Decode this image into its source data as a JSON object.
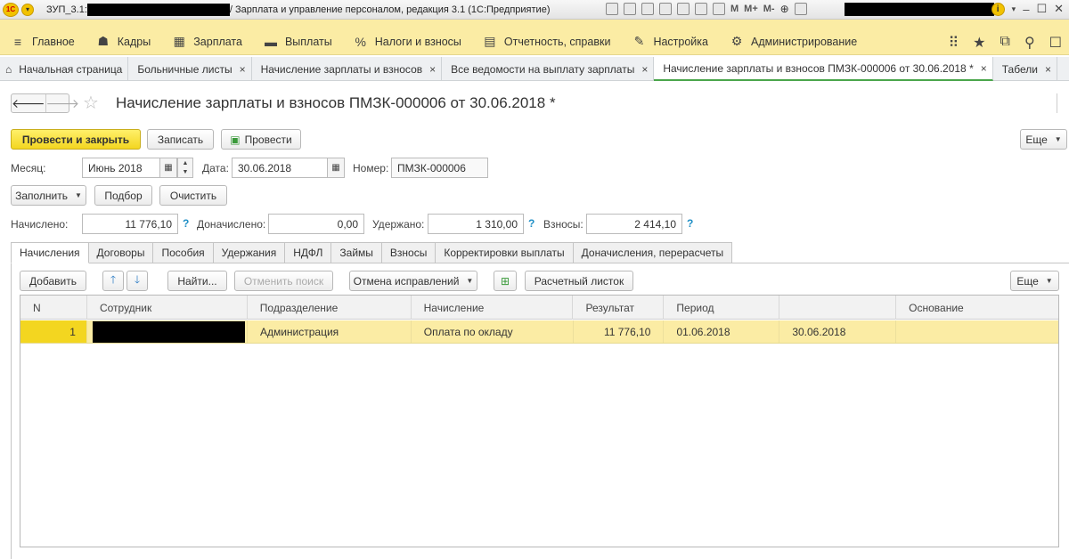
{
  "titlebar": {
    "logo": "1С",
    "app_prefix": "ЗУП_3.1:",
    "title": "/ Зарплата и управление персоналом, редакция 3.1  (1С:Предприятие)",
    "m_buttons": [
      "M",
      "M+",
      "M-"
    ]
  },
  "main_menu": [
    {
      "icon": "≡",
      "label": "Главное"
    },
    {
      "icon": "👥",
      "label": "Кадры"
    },
    {
      "icon": "▦",
      "label": "Зарплата"
    },
    {
      "icon": "▬",
      "label": "Выплаты"
    },
    {
      "icon": "%",
      "label": "Налоги и взносы"
    },
    {
      "icon": "▤",
      "label": "Отчетность, справки"
    },
    {
      "icon": "🔧",
      "label": "Настройка"
    },
    {
      "icon": "⚙",
      "label": "Администрирование"
    }
  ],
  "open_tabs": {
    "home": "Начальная страница",
    "tabs": [
      "Больничные листы",
      "Начисление зарплаты и взносов",
      "Все ведомости на выплату зарплаты",
      "Начисление зарплаты и взносов ПМЗК-000006 от 30.06.2018 *",
      "Табели"
    ],
    "close_symbol": "×"
  },
  "form": {
    "title": "Начисление зарплаты и взносов ПМЗК-000006 от 30.06.2018 *",
    "toolbar": {
      "post_and_close": "Провести и закрыть",
      "save": "Записать",
      "post": "Провести",
      "more": "Еще"
    },
    "month_label": "Месяц:",
    "month_value": "Июнь 2018",
    "date_label": "Дата:",
    "date_value": "30.06.2018",
    "number_label": "Номер:",
    "number_value": "ПМЗК-000006",
    "fill_button": "Заполнить",
    "select_button": "Подбор",
    "clear_button": "Очистить",
    "accrued_label": "Начислено:",
    "accrued_value": "11 776,10",
    "additional_label": "Доначислено:",
    "additional_value": "0,00",
    "withheld_label": "Удержано:",
    "withheld_value": "1 310,00",
    "contributions_label": "Взносы:",
    "contributions_value": "2 414,10",
    "help_symbol": "?"
  },
  "page_tabs": [
    "Начисления",
    "Договоры",
    "Пособия",
    "Удержания",
    "НДФЛ",
    "Займы",
    "Взносы",
    "Корректировки выплаты",
    "Доначисления, перерасчеты"
  ],
  "table_toolbar": {
    "add": "Добавить",
    "find": "Найти...",
    "cancel_search": "Отменить поиск",
    "cancel_corrections": "Отмена исправлений",
    "payslip": "Расчетный листок",
    "more": "Еще"
  },
  "table": {
    "columns": [
      "N",
      "Сотрудник",
      "Подразделение",
      "Начисление",
      "Результат",
      "Период",
      "",
      "Основание"
    ],
    "rows": [
      {
        "n": "1",
        "employee": "",
        "department": "Администрация",
        "accrual": "Оплата по окладу",
        "result": "11 776,10",
        "period_start": "01.06.2018",
        "period_end": "30.06.2018",
        "basis": ""
      }
    ]
  }
}
